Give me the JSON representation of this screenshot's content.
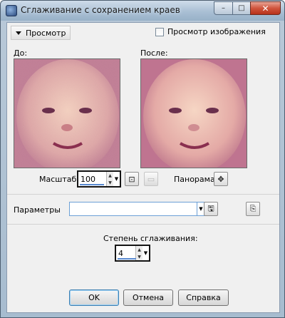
{
  "window": {
    "title": "Сглаживание с сохранением краев",
    "minimize_glyph": "–",
    "maximize_glyph": "□",
    "close_glyph": "✕"
  },
  "preview": {
    "toggle_label": "Просмотр",
    "image_preview_label": "Просмотр изображения",
    "image_preview_checked": false,
    "before_label": "До:",
    "after_label": "После:"
  },
  "zoom": {
    "label": "Масштаб:",
    "value": "100",
    "pan_label": "Панорама:",
    "zoom_icon": "zoom-to-fit-icon",
    "actual_size_icon": "actual-size-icon",
    "pan_icon": "pan-move-icon"
  },
  "parameters": {
    "label": "Параметры",
    "value": "",
    "save_icon": "save-floppy-icon",
    "reset_icon": "reset-defaults-icon"
  },
  "smoothing": {
    "label": "Степень сглаживания:",
    "value": "4"
  },
  "buttons": {
    "ok": "OK",
    "cancel": "Отмена",
    "help": "Справка"
  },
  "colors": {
    "title_bar": "#a9bfd4",
    "dialog_bg": "#f0f0f0",
    "close_button": "#c4412a",
    "focus_border": "#3c7fb1"
  }
}
